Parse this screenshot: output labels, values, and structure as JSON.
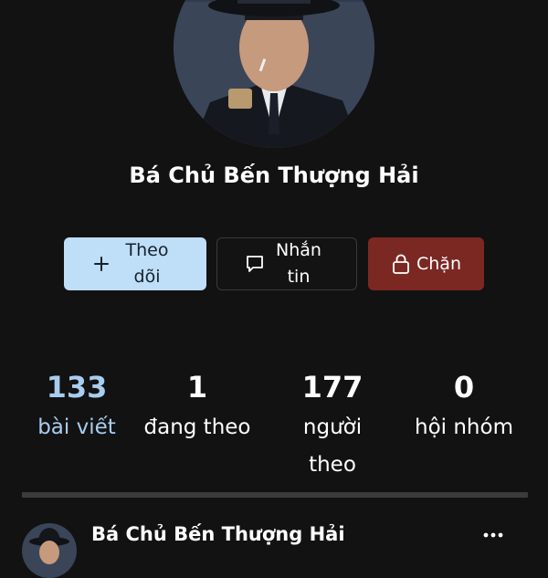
{
  "profile": {
    "name": "Bá Chủ Bến Thượng Hải"
  },
  "actions": {
    "follow_label": "Theo dõi",
    "message_label": "Nhắn tin",
    "block_label": "Chặn"
  },
  "stats": [
    {
      "value": "133",
      "label": "bài viết"
    },
    {
      "value": "1",
      "label": "đang theo"
    },
    {
      "value": "177",
      "label": "người theo"
    },
    {
      "value": "0",
      "label": "hội nhóm"
    }
  ],
  "post": {
    "author": "Bá Chủ Bến Thượng Hải"
  },
  "colors": {
    "background": "#121212",
    "follow_button": "#bfdef8",
    "block_button": "#7b2823",
    "accent_stat": "#a9cdee",
    "text": "#ffffff"
  },
  "icons": {
    "follow": "plus-icon",
    "message": "chat-bubble-icon",
    "block": "lock-icon",
    "more": "more-horizontal-icon"
  }
}
